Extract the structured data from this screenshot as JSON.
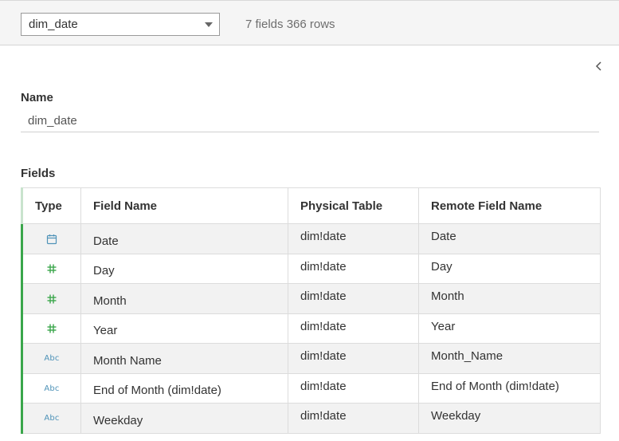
{
  "header": {
    "table_select_value": "dim_date",
    "meta": "7 fields 366 rows"
  },
  "detail": {
    "name_label": "Name",
    "name_value": "dim_date",
    "fields_label": "Fields"
  },
  "fields_table": {
    "columns": [
      "Type",
      "Field Name",
      "Physical Table",
      "Remote Field Name"
    ],
    "rows": [
      {
        "type": "date",
        "type_icon": "calendar-icon",
        "field_name": "Date",
        "physical_table": "dim!date",
        "remote_field_name": "Date"
      },
      {
        "type": "number",
        "type_icon": "hash-icon",
        "field_name": "Day",
        "physical_table": "dim!date",
        "remote_field_name": "Day"
      },
      {
        "type": "number",
        "type_icon": "hash-icon",
        "field_name": "Month",
        "physical_table": "dim!date",
        "remote_field_name": "Month"
      },
      {
        "type": "number",
        "type_icon": "hash-icon",
        "field_name": "Year",
        "physical_table": "dim!date",
        "remote_field_name": "Year"
      },
      {
        "type": "string",
        "type_icon": "abc-icon",
        "type_text": "Abc",
        "field_name": "Month Name",
        "physical_table": "dim!date",
        "remote_field_name": "Month_Name"
      },
      {
        "type": "string",
        "type_icon": "abc-icon",
        "type_text": "Abc",
        "field_name": "End of Month (dim!date)",
        "physical_table": "dim!date",
        "remote_field_name": "End of Month (dim!date)"
      },
      {
        "type": "string",
        "type_icon": "abc-icon",
        "type_text": "Abc",
        "field_name": "Weekday",
        "physical_table": "dim!date",
        "remote_field_name": "Weekday"
      }
    ]
  },
  "colors": {
    "measure_green": "#3aa64b",
    "dimension_blue": "#4f93b8",
    "zebra_row": "#f2f2f2"
  }
}
